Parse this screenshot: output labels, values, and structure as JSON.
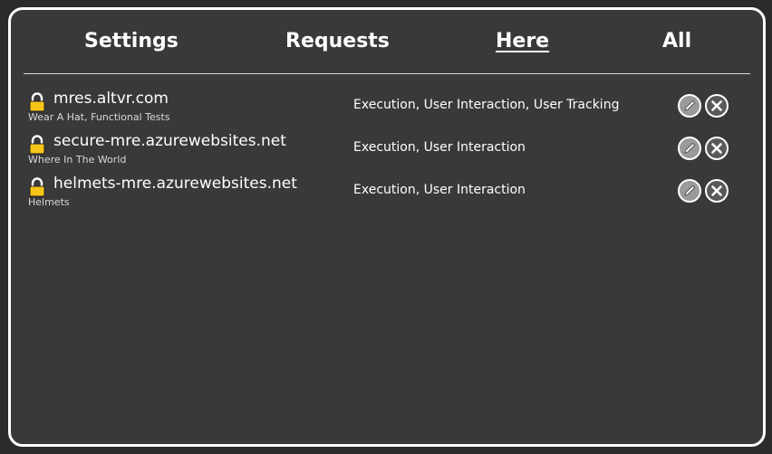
{
  "tabs": [
    {
      "label": "Settings",
      "active": false
    },
    {
      "label": "Requests",
      "active": false
    },
    {
      "label": "Here",
      "active": true
    },
    {
      "label": "All",
      "active": false
    }
  ],
  "sites": [
    {
      "host": "mres.altvr.com",
      "apps": "Wear A Hat, Functional Tests",
      "permissions": "Execution, User Interaction, User Tracking",
      "lock_icon": "lock-icon"
    },
    {
      "host": "secure-mre.azurewebsites.net",
      "apps": "Where In The World",
      "permissions": "Execution, User Interaction",
      "lock_icon": "lock-icon"
    },
    {
      "host": "helmets-mre.azurewebsites.net",
      "apps": "Helmets",
      "permissions": "Execution, User Interaction",
      "lock_icon": "lock-icon"
    }
  ],
  "icons": {
    "edit": "pencil-icon",
    "remove": "close-icon"
  },
  "colors": {
    "background": "#393939",
    "border": "#ffffff",
    "lock": "#f5c518",
    "text": "#ffffff"
  }
}
